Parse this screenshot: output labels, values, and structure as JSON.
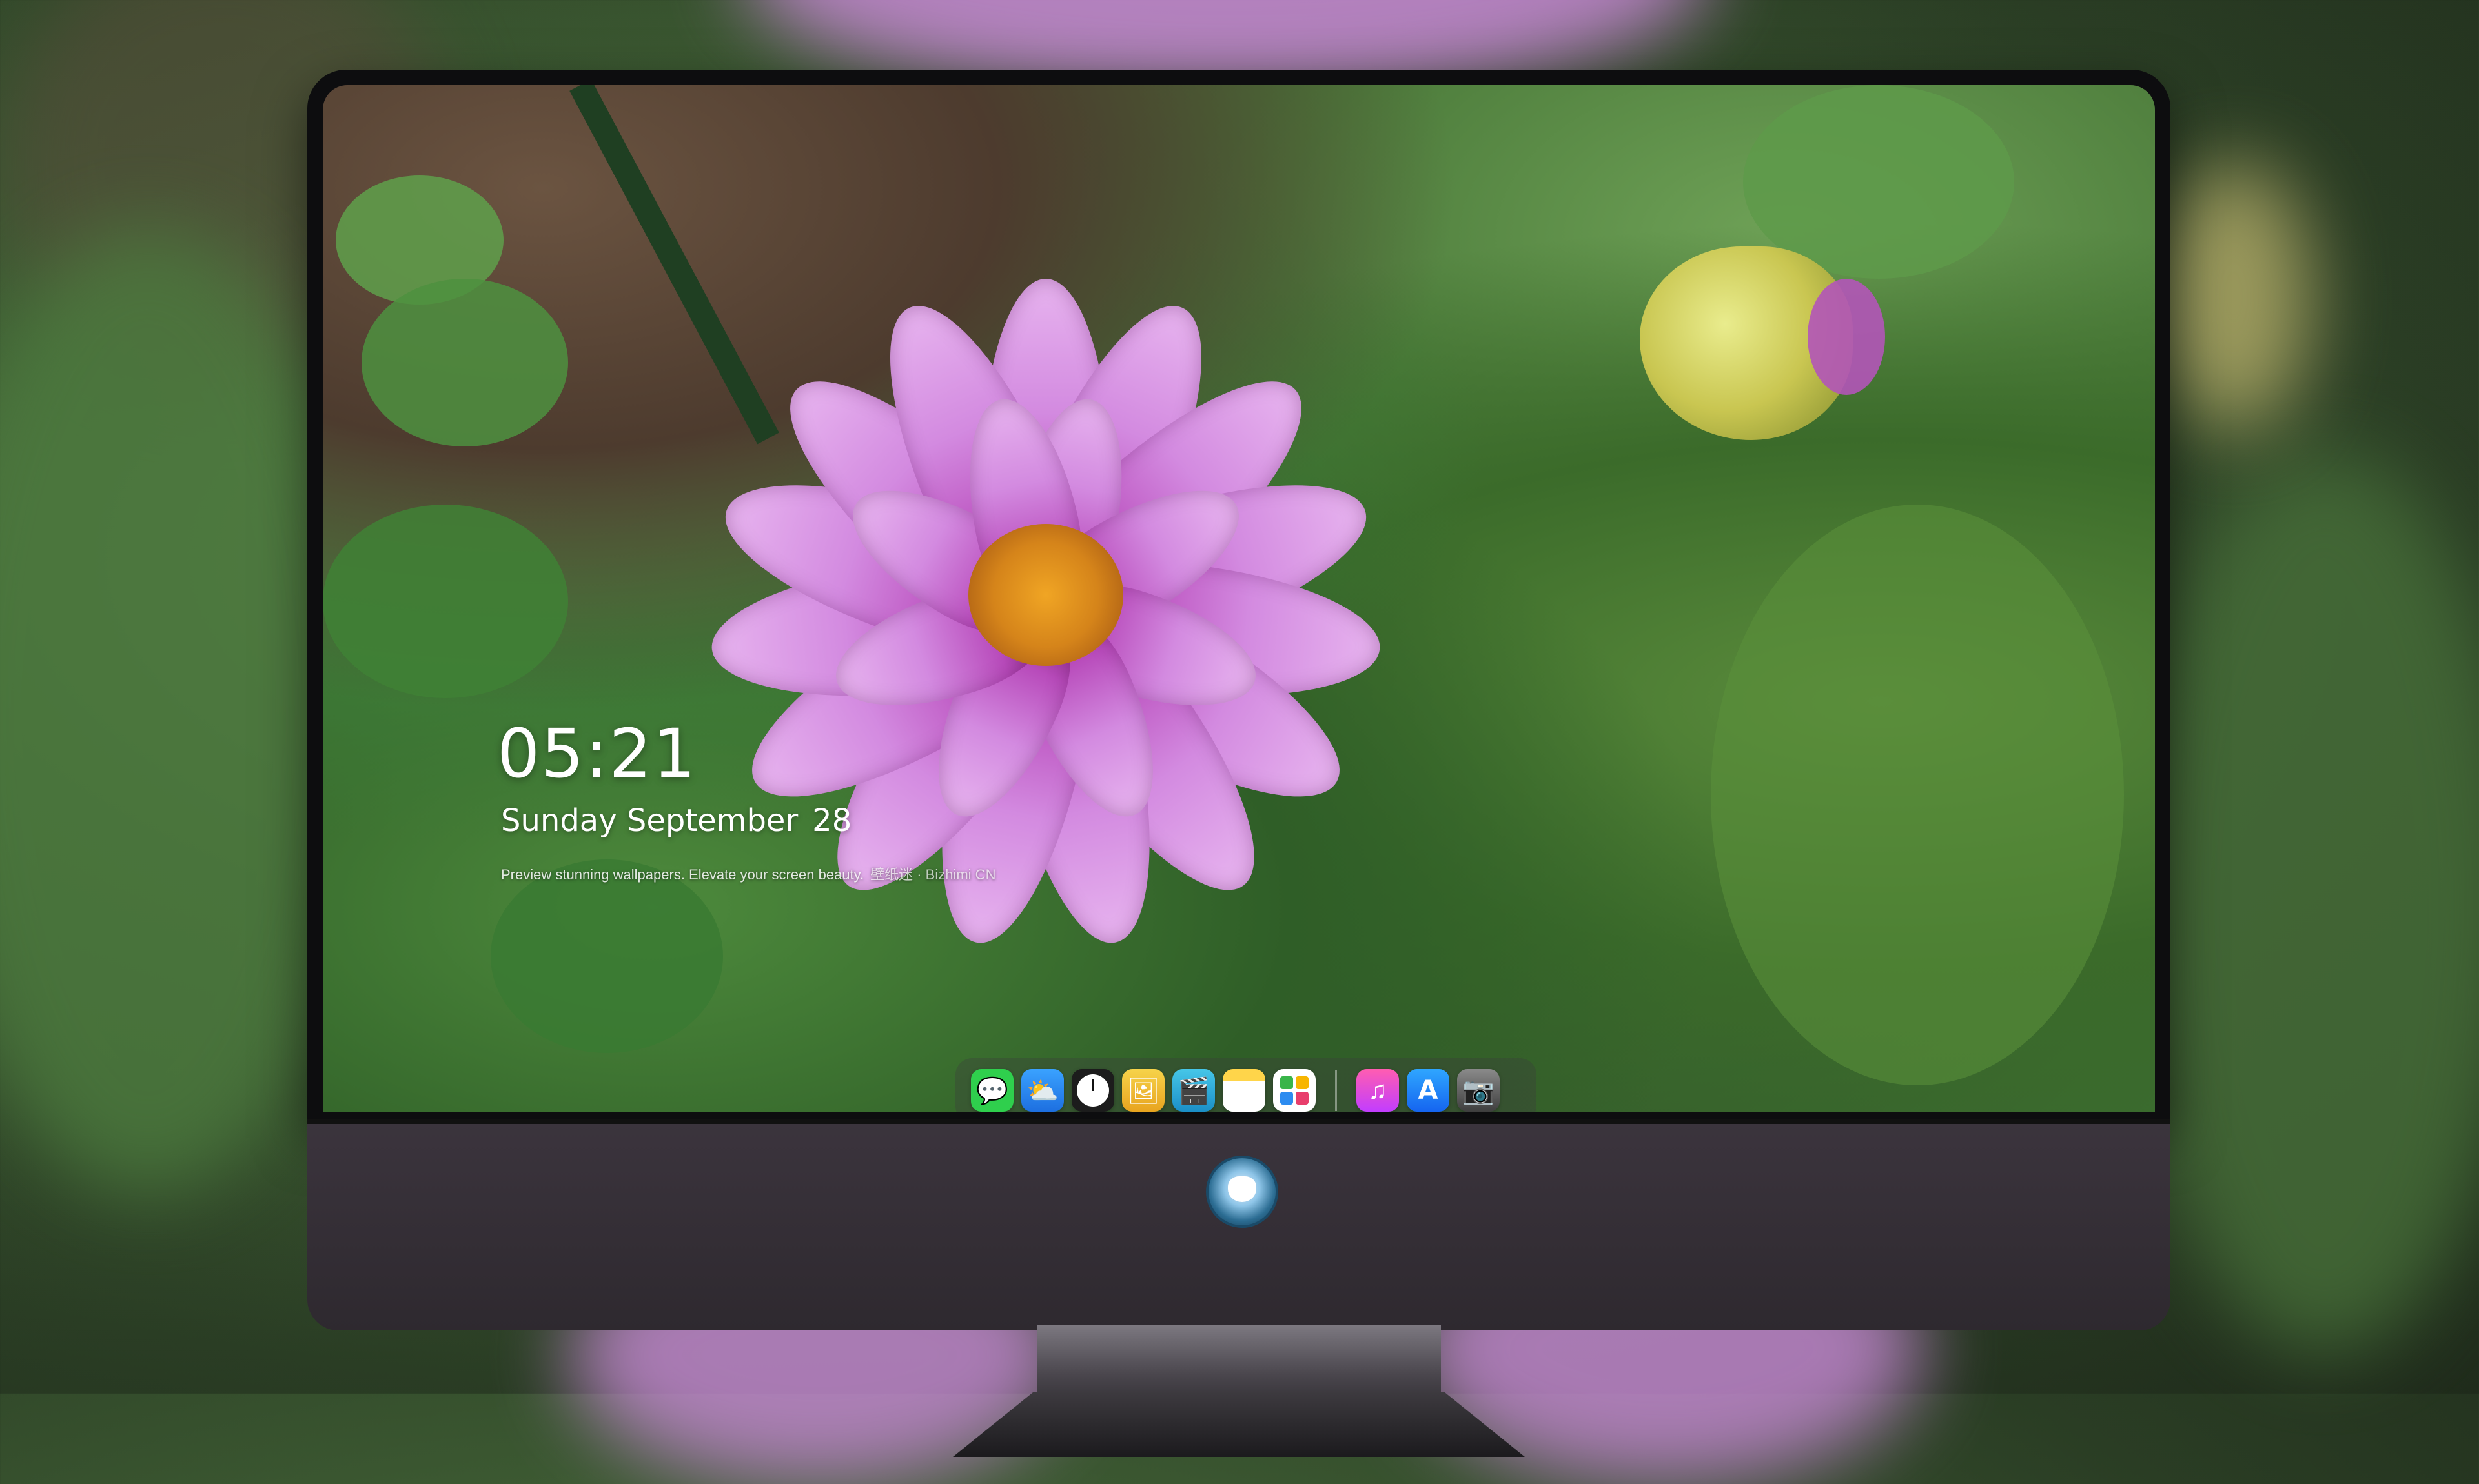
{
  "lockscreen": {
    "time": "05:21",
    "weekday_month": "Sunday September",
    "day": "28",
    "tagline": "Preview stunning wallpapers. Elevate your screen beauty.",
    "brand": "壁纸迷 · Bizhimi CN"
  },
  "dock": {
    "items": [
      {
        "icon": "messages-icon",
        "glyph": "💬"
      },
      {
        "icon": "weather-icon",
        "glyph": "⛅"
      },
      {
        "icon": "clock-icon",
        "glyph": ""
      },
      {
        "icon": "preview-icon",
        "glyph": "🖼"
      },
      {
        "icon": "claquette-icon",
        "glyph": "🎬"
      },
      {
        "icon": "notes-icon",
        "glyph": ""
      },
      {
        "icon": "photos-icon",
        "glyph": ""
      },
      {
        "icon": "music-icon",
        "glyph": "♫"
      },
      {
        "icon": "app-store-icon",
        "glyph": "A"
      },
      {
        "icon": "camera-icon",
        "glyph": "📷"
      }
    ]
  },
  "colors": {
    "accent_pink": "#d38ae0",
    "bezel": "#0d0d0f",
    "chin": "#3b343d"
  }
}
